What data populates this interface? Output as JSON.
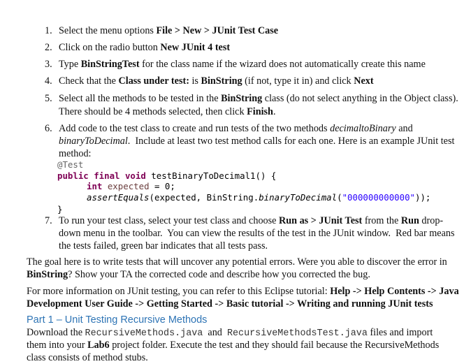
{
  "steps": [
    {
      "number": "1.",
      "lines": [
        [
          {
            "t": "Select the menu options "
          },
          {
            "t": "File > New > JUnit Test Case",
            "b": true
          }
        ]
      ]
    },
    {
      "number": "2.",
      "lines": [
        [
          {
            "t": "Click on the radio button "
          },
          {
            "t": "New JUnit 4 test",
            "b": true
          }
        ]
      ]
    },
    {
      "number": "3.",
      "lines": [
        [
          {
            "t": "Type "
          },
          {
            "t": "BinStringTest",
            "b": true
          },
          {
            "t": " for the class name if the wizard does not automatically create this name"
          }
        ]
      ]
    },
    {
      "number": "4.",
      "lines": [
        [
          {
            "t": "Check that the "
          },
          {
            "t": "Class under test:",
            "b": true
          },
          {
            "t": " is "
          },
          {
            "t": "BinString",
            "b": true
          },
          {
            "t": " (if not, type it in) and click "
          },
          {
            "t": "Next",
            "b": true
          }
        ]
      ]
    },
    {
      "number": "5.",
      "lines": [
        [
          {
            "t": "Select all the methods to be tested in the "
          },
          {
            "t": "BinString",
            "b": true
          },
          {
            "t": " class (do not select anything in the Object class)."
          }
        ],
        [
          {
            "t": "There should be 4 methods selected, then click "
          },
          {
            "t": "Finish",
            "b": true
          },
          {
            "t": "."
          }
        ]
      ]
    },
    {
      "number": "6.",
      "lines": [
        [
          {
            "t": "Add code to the test class to create and run tests of the two methods "
          },
          {
            "t": "decimaltoBinary",
            "i": true
          },
          {
            "t": " and"
          }
        ],
        [
          {
            "t": "binaryToDecimal",
            "i": true
          },
          {
            "t": ".  Include at least two test method calls for each one. Here is an example JUnit test"
          }
        ],
        [
          {
            "t": "method:"
          }
        ]
      ]
    },
    {
      "number": "7.",
      "lines": [
        [
          {
            "t": "To run your test class, select your test class and choose "
          },
          {
            "t": "Run as > JUnit Test",
            "b": true
          },
          {
            "t": " from the "
          },
          {
            "t": "Run",
            "b": true
          },
          {
            "t": " drop-"
          }
        ],
        [
          {
            "t": "down menu in the toolbar.  You can view the results of the test in the JUnit window.  Red bar means"
          }
        ],
        [
          {
            "t": "the tests failed, green bar indicates that all tests pass."
          }
        ]
      ]
    }
  ],
  "code_example": {
    "annotation": "@Test",
    "signature_keywords": "public final void",
    "method_name": " testBinaryToDecimal1() {",
    "decl_type": "int",
    "decl_var": " expected",
    "decl_rest": " = 0;",
    "assert_call": "assertEquals",
    "assert_args_start": "(expected, BinString.",
    "assert_method": "binaryToDecimal",
    "assert_paren": "(",
    "assert_string": "\"000000000000\"",
    "assert_end": "));",
    "closing_brace": "}"
  },
  "paragraphs": [
    {
      "lines": [
        [
          {
            "t": "The goal here is to write tests that will uncover any potential errors. Were you able to discover the error in"
          }
        ],
        [
          {
            "t": "BinString",
            "b": true
          },
          {
            "t": "? Show your TA the corrected code and describe how you corrected the bug."
          }
        ]
      ]
    },
    {
      "lines": [
        [
          {
            "t": "For more information on JUnit testing, you can refer to this Eclipse tutorial: "
          },
          {
            "t": "Help -> Help Contents -> Java",
            "b": true
          }
        ],
        [
          {
            "t": "Development User Guide -> Getting Started -> Basic tutorial -> Writing and running JUnit tests",
            "b": true
          }
        ]
      ]
    }
  ],
  "section": {
    "heading": "Part 1 – Unit Testing Recursive Methods",
    "lines": [
      [
        {
          "t": "Download the "
        },
        {
          "t": "RecursiveMethods.java",
          "m": true
        },
        {
          "t": "  and  "
        },
        {
          "t": "RecursiveMethodsTest.java",
          "m": true
        },
        {
          "t": " files and import"
        }
      ],
      [
        {
          "t": "them into your "
        },
        {
          "t": "Lab6",
          "b": true
        },
        {
          "t": " project folder. Execute the test and they should fail because the RecursiveMethods"
        }
      ],
      [
        {
          "t": "class consists of method stubs."
        }
      ]
    ]
  },
  "colors": {
    "heading": "#2e74b5",
    "code_keyword": "#7f0055",
    "code_string": "#2a00ff",
    "code_annotation": "#646464",
    "code_variable": "#6a3e3e"
  }
}
